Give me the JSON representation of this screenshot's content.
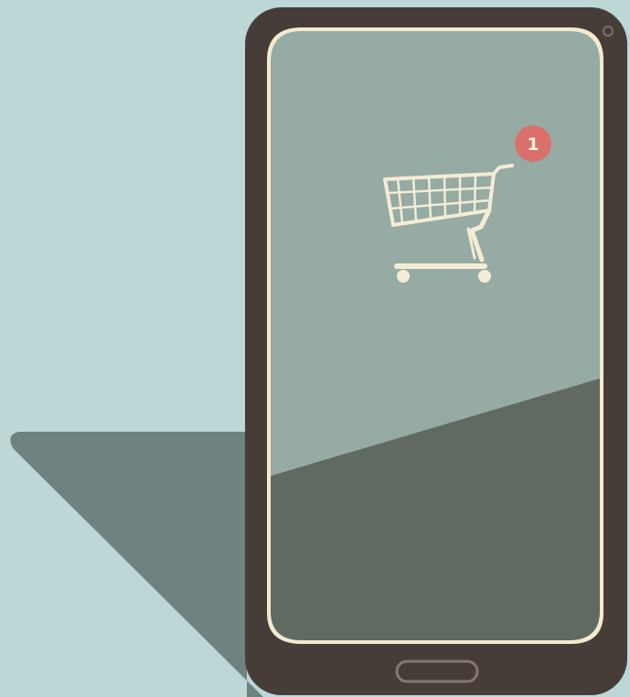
{
  "scene": {
    "description_icons": [
      "smartphone-icon",
      "shopping-cart-icon",
      "notification-badge-icon",
      "home-button-icon",
      "front-camera-icon"
    ],
    "colors": {
      "background": "#bcd7d6",
      "wall_shadow": "#6e827f",
      "phone_body": "#463d39",
      "screen_upper": "#95aba3",
      "screen_lower": "#616a62",
      "screen_rim": "#f3ead0",
      "cart": "#f4ecd6",
      "badge": "#d9716a",
      "badge_text": "#f7efe1"
    }
  },
  "cart_badge": {
    "count": "1"
  }
}
